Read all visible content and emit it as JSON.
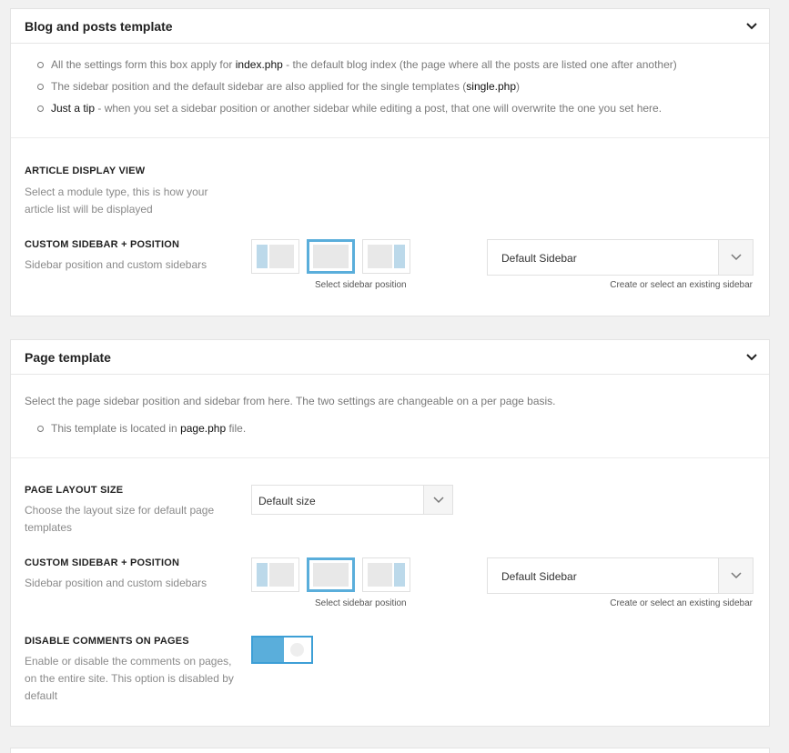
{
  "colors": {
    "accent": "#5aaedb",
    "toggle_on": "#3d9fd6",
    "sidebar_block": "#bcd9ea",
    "content_block": "#e8e8e8"
  },
  "blog_panel": {
    "title": "Blog and posts template",
    "collapse_icon": "chevron-down-icon",
    "bullets": [
      {
        "pre": "All the settings form this box apply for ",
        "strong": "index.php",
        "post": " - the default blog index (the page where all the posts are listed one after another)"
      },
      {
        "pre": "The sidebar position and the default sidebar are also applied for the single templates (",
        "strong": "single.php",
        "post": ")"
      },
      {
        "pre": "",
        "strong": "Just a tip",
        "post": " - when you set a sidebar position or another sidebar while editing a post, that one will overwrite the one you set here."
      }
    ],
    "article_view": {
      "title": "ARTICLE DISPLAY VIEW",
      "desc": "Select a module type, this is how your article list will be displayed"
    },
    "sidebar": {
      "title": "CUSTOM SIDEBAR + POSITION",
      "desc": "Sidebar position and custom sidebars",
      "position_caption": "Select sidebar position",
      "selected": "no-sidebar",
      "select_value": "Default Sidebar",
      "select_caption": "Create or select an existing sidebar"
    }
  },
  "page_panel": {
    "title": "Page template",
    "collapse_icon": "chevron-down-icon",
    "intro": "Select the page sidebar position and sidebar from here. The two settings are changeable on a per page basis.",
    "bullets": [
      {
        "pre": "This template is located in ",
        "strong": "page.php",
        "post": " file."
      }
    ],
    "layout_size": {
      "title": "PAGE LAYOUT SIZE",
      "desc": "Choose the layout size for default page templates",
      "select_value": "Default size"
    },
    "sidebar": {
      "title": "CUSTOM SIDEBAR + POSITION",
      "desc": "Sidebar position and custom sidebars",
      "position_caption": "Select sidebar position",
      "selected": "no-sidebar",
      "select_value": "Default Sidebar",
      "select_caption": "Create or select an existing sidebar"
    },
    "comments": {
      "title": "DISABLE COMMENTS ON PAGES",
      "desc": "Enable or disable the comments on pages, on the entire site. This option is disabled by default",
      "enabled": true
    }
  }
}
